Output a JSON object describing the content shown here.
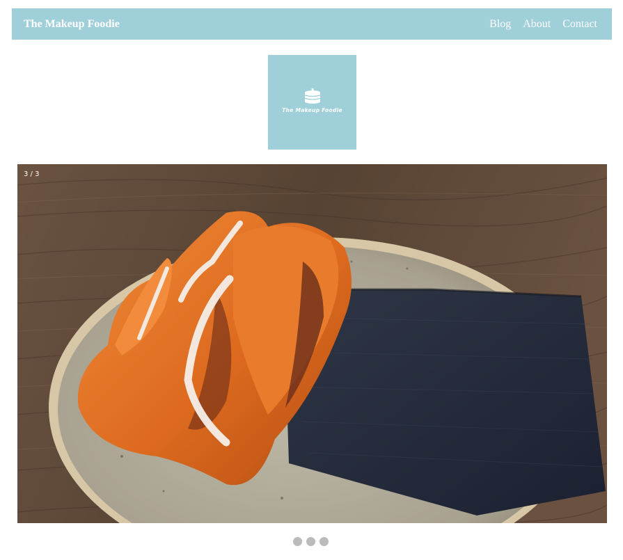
{
  "header": {
    "brand": "The Makeup Foodie",
    "nav": [
      {
        "label": "Blog"
      },
      {
        "label": "About"
      },
      {
        "label": "Contact"
      }
    ],
    "bg_color": "#9fcfd9"
  },
  "logo": {
    "text": "The Makeup Foodie",
    "icon": "pancake-stack-icon"
  },
  "slideshow": {
    "counter": "3 / 3",
    "current": 3,
    "total": 3,
    "slide_content": "cinnamon bun on a speckled plate with a dark napkin on a wooden table",
    "dots": [
      {
        "active": false
      },
      {
        "active": false
      },
      {
        "active": false
      }
    ]
  }
}
